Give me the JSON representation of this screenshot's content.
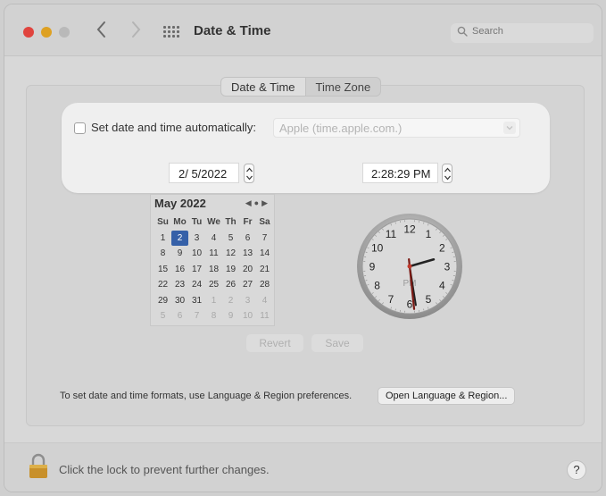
{
  "window": {
    "title": "Date & Time"
  },
  "search": {
    "placeholder": "Search"
  },
  "tabs": [
    {
      "label": "Date & Time",
      "active": true
    },
    {
      "label": "Time Zone",
      "active": false
    }
  ],
  "auto": {
    "label": "Set date and time automatically:",
    "checked": false,
    "server": "Apple (time.apple.com.)"
  },
  "date_value": "2/  5/2022",
  "time_value": "2:28:29 PM",
  "calendar": {
    "title": "May 2022",
    "weekdays": [
      "Su",
      "Mo",
      "Tu",
      "We",
      "Th",
      "Fr",
      "Sa"
    ],
    "weeks": [
      [
        "1",
        "2",
        "3",
        "4",
        "5",
        "6",
        "7"
      ],
      [
        "8",
        "9",
        "10",
        "11",
        "12",
        "13",
        "14"
      ],
      [
        "15",
        "16",
        "17",
        "18",
        "19",
        "20",
        "21"
      ],
      [
        "22",
        "23",
        "24",
        "25",
        "26",
        "27",
        "28"
      ],
      [
        "29",
        "30",
        "31",
        "1",
        "2",
        "3",
        "4"
      ],
      [
        "5",
        "6",
        "7",
        "8",
        "9",
        "10",
        "11"
      ]
    ],
    "selected_day": "2"
  },
  "clock": {
    "numbers": [
      "12",
      "1",
      "2",
      "3",
      "4",
      "5",
      "6",
      "7",
      "8",
      "9",
      "10",
      "11"
    ],
    "period": "PM",
    "hour": 2,
    "minute": 28,
    "second": 29
  },
  "buttons": {
    "revert": "Revert",
    "save": "Save",
    "open_language": "Open Language & Region..."
  },
  "formats_text": "To set date and time formats, use Language & Region preferences.",
  "lock_text": "Click the lock to prevent further changes.",
  "help_label": "?",
  "colors": {
    "selected_day": "#3560a8",
    "close": "#e0443e",
    "minimize": "#dea123",
    "second_hand": "#7a1a14"
  }
}
